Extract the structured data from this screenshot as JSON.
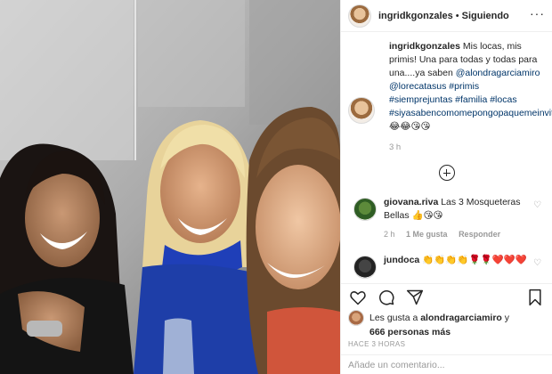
{
  "header": {
    "username": "ingridkgonzales",
    "separator": "•",
    "follow_status": "Siguiendo"
  },
  "caption": {
    "username": "ingridkgonzales",
    "text_before": "Mis locas, mis primis! Una para todas y todas para una....ya saben",
    "mention_1": "@alondragarciamiro",
    "mention_2": "@lorecatasus",
    "tags": "#primis #siemprejuntas #familia #locas #siyasabencomomepongopaquemeinvitan",
    "emoji": "😂😂😘😘",
    "time": "3 h"
  },
  "comments": [
    {
      "username": "giovana.riva",
      "text": "Las 3 Mosqueteras Bellas 👍😘😘",
      "time": "2 h",
      "likes": "1 Me gusta",
      "reply": "Responder"
    },
    {
      "username": "jundoca",
      "text": "👏👏👏👏🌹🌹❤️❤️❤️"
    }
  ],
  "likes": {
    "prefix": "Les gusta a",
    "user": "alondragarciamiro",
    "connector": "y",
    "others": "666 personas más"
  },
  "posted_ago": "HACE 3 HORAS",
  "add_comment_placeholder": "Añade un comentario...",
  "icons": [
    "more-icon",
    "plus-circle-icon",
    "heart-icon",
    "comment-icon",
    "share-icon",
    "bookmark-icon"
  ],
  "colors": {
    "link": "#003569",
    "muted": "#999999",
    "border": "#efefef",
    "text": "#262626"
  }
}
